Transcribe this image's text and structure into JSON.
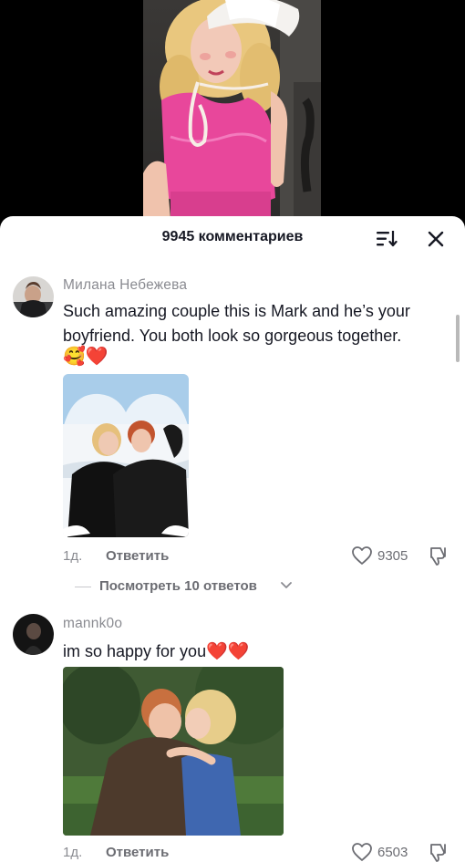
{
  "sheet": {
    "title": "9945 комментариев",
    "icons": {
      "sort": "sort-icon",
      "close": "close-icon"
    }
  },
  "comments": [
    {
      "username": "Милана Небежева",
      "text": "Such amazing couple this is Mark and he’s your boyfriend. You both look so gorgeous together.",
      "emoji": "🥰❤️",
      "image": "couple-photo-snow-heart-frame",
      "date": "1д.",
      "reply_label": "Ответить",
      "likes": "9305",
      "view_replies": "Посмотреть 10 ответов"
    },
    {
      "username": "mannk0o",
      "text": "im so happy for you",
      "emoji": "❤️❤️",
      "image": "couple-photo-kiss",
      "date": "1д.",
      "reply_label": "Ответить",
      "likes": "6503"
    }
  ],
  "colors": {
    "text": "#161823",
    "muted": "#8a8b91",
    "sheet": "#ffffff",
    "video_bg": "#000000"
  }
}
